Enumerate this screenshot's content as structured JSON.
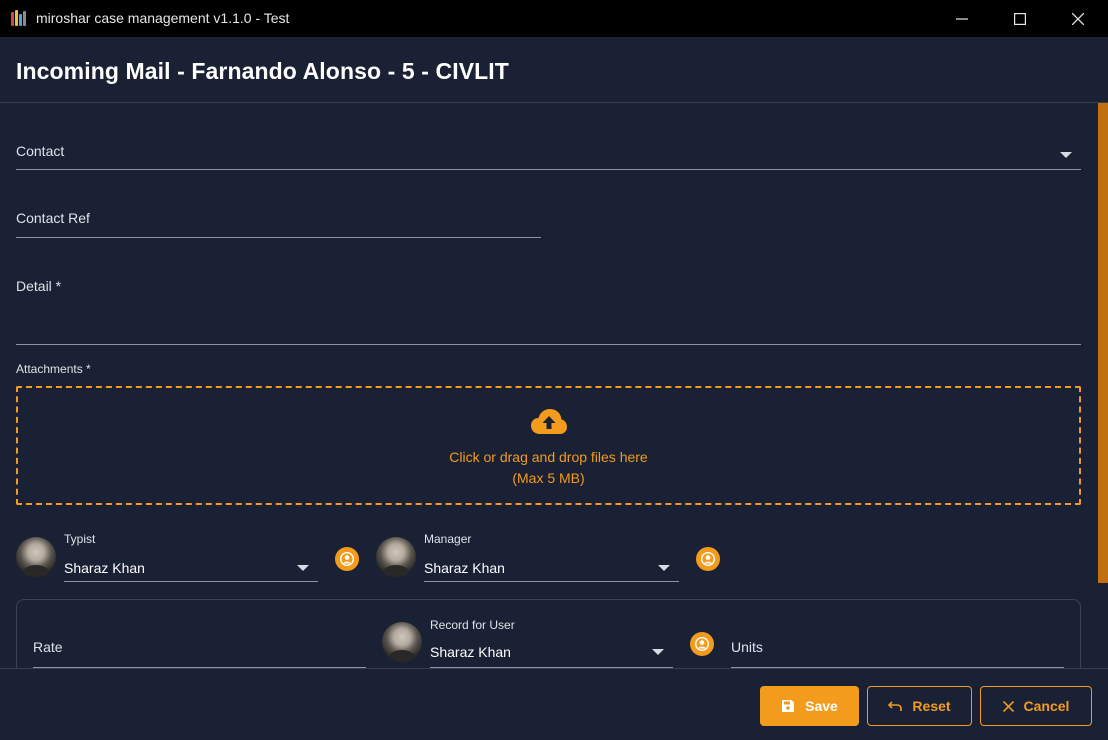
{
  "window": {
    "title": "miroshar case management v1.1.0 - Test",
    "minimize_icon": "minimize-icon",
    "maximize_icon": "maximize-icon",
    "close_icon": "close-icon"
  },
  "header": {
    "title": "Incoming Mail - Farnando Alonso - 5 - CIVLIT"
  },
  "form": {
    "contact": {
      "label": "Contact",
      "value": ""
    },
    "contact_ref": {
      "label": "Contact Ref",
      "value": ""
    },
    "detail": {
      "label": "Detail *",
      "value": ""
    },
    "attachments": {
      "label": "Attachments *",
      "drop_text": "Click or drag and drop files here",
      "limit_text": "(Max 5 MB)",
      "icon": "cloud-upload-icon"
    },
    "typist": {
      "label": "Typist",
      "value": "Sharaz Khan"
    },
    "manager": {
      "label": "Manager",
      "value": "Sharaz Khan"
    },
    "time_entry": {
      "rate": {
        "label": "Rate",
        "value": ""
      },
      "record_for_user": {
        "label": "Record for User",
        "value": "Sharaz Khan"
      },
      "units": {
        "label": "Units",
        "value": ""
      }
    }
  },
  "footer": {
    "save_label": "Save",
    "reset_label": "Reset",
    "cancel_label": "Cancel"
  },
  "colors": {
    "accent": "#f29b1d",
    "background": "#1b2134",
    "titlebar": "#000000"
  }
}
